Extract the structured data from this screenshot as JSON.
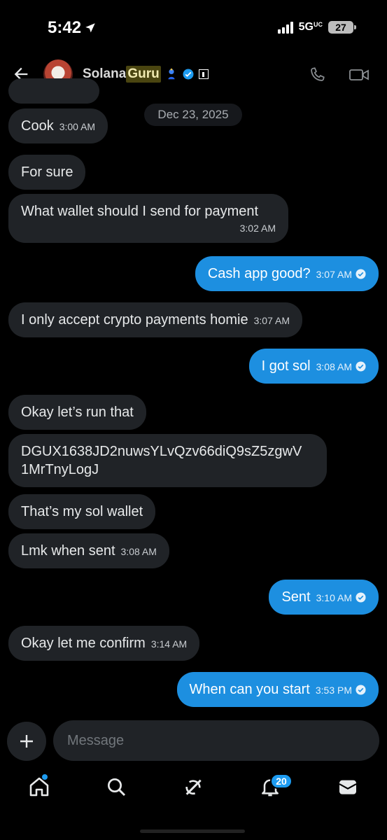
{
  "status_bar": {
    "time": "5:42",
    "network": "5G",
    "network_suffix": "UC",
    "battery": "27"
  },
  "header": {
    "name_plain": "Solana",
    "name_highlight": "Guru"
  },
  "date_chip": "Dec 23, 2025",
  "messages": [
    {
      "dir": "in",
      "text": "Cook",
      "time": "3:00 AM"
    },
    {
      "dir": "in",
      "text": "For sure",
      "time": ""
    },
    {
      "dir": "in",
      "text": "What wallet should I send for payment",
      "time": "3:02 AM"
    },
    {
      "dir": "out",
      "text": "Cash app good?",
      "time": "3:07 AM"
    },
    {
      "dir": "in",
      "text": "I only accept crypto payments homie",
      "time": "3:07 AM"
    },
    {
      "dir": "out",
      "text": "I got sol",
      "time": "3:08 AM"
    },
    {
      "dir": "in",
      "text": "Okay let’s run that",
      "time": ""
    },
    {
      "dir": "in",
      "text": "DGUX1638JD2nuwsYLvQzv66diQ9sZ5zgwV",
      "text2": "1MrTnyLogJ",
      "time": ""
    },
    {
      "dir": "in",
      "text": "That’s my sol wallet",
      "time": ""
    },
    {
      "dir": "in",
      "text": "Lmk when sent",
      "time": "3:08 AM"
    },
    {
      "dir": "out",
      "text": "Sent",
      "time": "3:10 AM"
    },
    {
      "dir": "in",
      "text": "Okay let me confirm",
      "time": "3:14 AM"
    },
    {
      "dir": "out",
      "text": "When can you start",
      "time": "3:53 PM"
    }
  ],
  "composer": {
    "placeholder": "Message"
  },
  "nav": {
    "notification_count": "20"
  },
  "colors": {
    "accent": "#1d9bf0",
    "outgoing": "#1d8fe0",
    "incoming": "#202327",
    "background": "#000000"
  }
}
